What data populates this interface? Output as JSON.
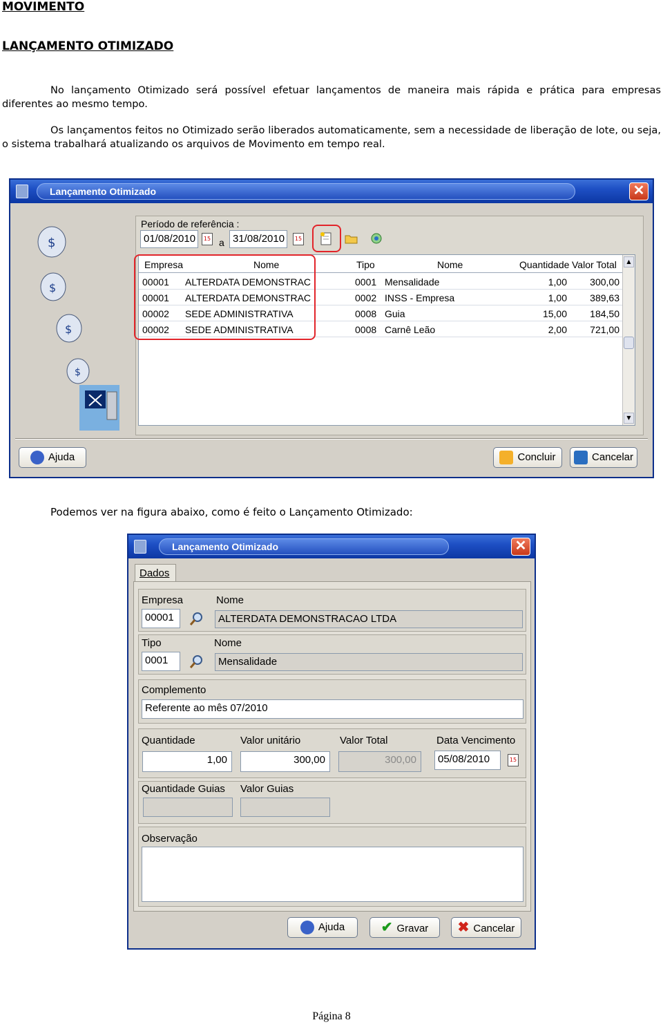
{
  "heading": "MOVIMENTO",
  "subheading": "LANÇAMENTO OTIMIZADO",
  "paragraph1": "No lançamento Otimizado será possível efetuar lançamentos de maneira mais rápida e prática para empresas diferentes ao mesmo tempo.",
  "paragraph2": "Os lançamentos feitos no Otimizado serão liberados automaticamente, sem a necessidade de liberação de lote, ou seja, o sistema trabalhará atualizando os arquivos de Movimento em tempo real.",
  "caption": "Podemos ver na figura abaixo, como é feito o Lançamento Otimizado:",
  "footer": "Página 8",
  "window1": {
    "title": "Lançamento Otimizado",
    "period_label": "Período de referência :",
    "date_from": "01/08/2010",
    "date_sep": "a",
    "date_to": "31/08/2010",
    "calendar_glyph": "15",
    "columns": [
      "Empresa",
      "Nome",
      "Tipo",
      "Nome",
      "Quantidade",
      "Valor Total"
    ],
    "rows": [
      [
        "00001",
        "ALTERDATA DEMONSTRAC",
        "0001",
        "Mensalidade",
        "1,00",
        "300,00"
      ],
      [
        "00001",
        "ALTERDATA DEMONSTRAC",
        "0002",
        "INSS - Empresa",
        "1,00",
        "389,63"
      ],
      [
        "00002",
        "SEDE ADMINISTRATIVA",
        "0008",
        "Guia",
        "15,00",
        "184,50"
      ],
      [
        "00002",
        "SEDE ADMINISTRATIVA",
        "0008",
        "Carnê Leão",
        "2,00",
        "721,00"
      ]
    ],
    "buttons": {
      "help": "Ajuda",
      "confirm": "Concluir",
      "cancel": "Cancelar"
    }
  },
  "window2": {
    "title": "Lançamento Otimizado",
    "tab": "Dados",
    "empresa_label": "Empresa",
    "empresa_nome_label": "Nome",
    "empresa_code": "00001",
    "empresa_nome": "ALTERDATA DEMONSTRACAO LTDA",
    "tipo_label": "Tipo",
    "tipo_nome_label": "Nome",
    "tipo_code": "0001",
    "tipo_nome": "Mensalidade",
    "complemento_label": "Complemento",
    "complemento": "Referente ao mês 07/2010",
    "quantidade_label": "Quantidade",
    "valor_unitario_label": "Valor unitário",
    "valor_total_label": "Valor Total",
    "data_venc_label": "Data Vencimento",
    "quantidade": "1,00",
    "valor_unitario": "300,00",
    "valor_total": "300,00",
    "data_venc": "05/08/2010",
    "calendar_glyph": "15",
    "qtd_guias_label": "Quantidade Guias",
    "valor_guias_label": "Valor Guias",
    "observacao_label": "Observação",
    "buttons": {
      "help": "Ajuda",
      "save": "Gravar",
      "cancel": "Cancelar"
    }
  },
  "colors": {
    "highlight": "#e2242a",
    "titlebar": "#1e4fc4",
    "dialog": "#d4d0c8"
  }
}
